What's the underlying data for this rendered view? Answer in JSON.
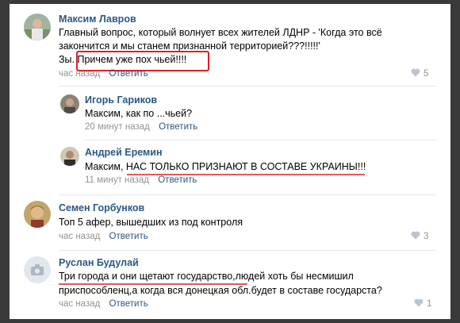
{
  "comments": [
    {
      "author": "Максим Лавров",
      "lines": [
        "Главный вопрос, который волнует всех жителей ЛДНР - 'Когда это всё",
        "закончится и мы станем признанной территорией???!!!!!'",
        "Зы. Причем уже пох чьей!!!!"
      ],
      "time": "час назад",
      "reply_label": "Ответить",
      "likes": "5"
    },
    {
      "author": "Игорь Гариков",
      "lines": [
        "Максим, как по ...чьей?"
      ],
      "time": "20 минут назад",
      "reply_label": "Ответить"
    },
    {
      "author": "Андрей Еремин",
      "lines": [
        "Максим, НАС ТОЛЬКО ПРИЗНАЮТ В СОСТАВЕ УКРАИНЫ!!!"
      ],
      "time": "11 минут назад",
      "reply_label": "Ответить"
    },
    {
      "author": "Семен Горбунков",
      "lines": [
        "Топ 5 афер, вышедших из под контроля"
      ],
      "time": "час назад",
      "reply_label": "Ответить",
      "likes": "3"
    },
    {
      "author": "Руслан Будулай",
      "lines": [
        "Три города и они щетают государство,людей хоть бы несмишил",
        "приспособленц,а когда вся донецкая обл.будет в составе государста?"
      ],
      "time": "час назад",
      "reply_label": "Ответить",
      "likes": "1"
    }
  ],
  "colors": {
    "link": "#2a5885",
    "meta": "#939393",
    "highlight": "#e02020",
    "underline": "#e35959",
    "background": "#3a3a3a"
  },
  "icons": [
    "heart-icon",
    "camera-icon"
  ]
}
